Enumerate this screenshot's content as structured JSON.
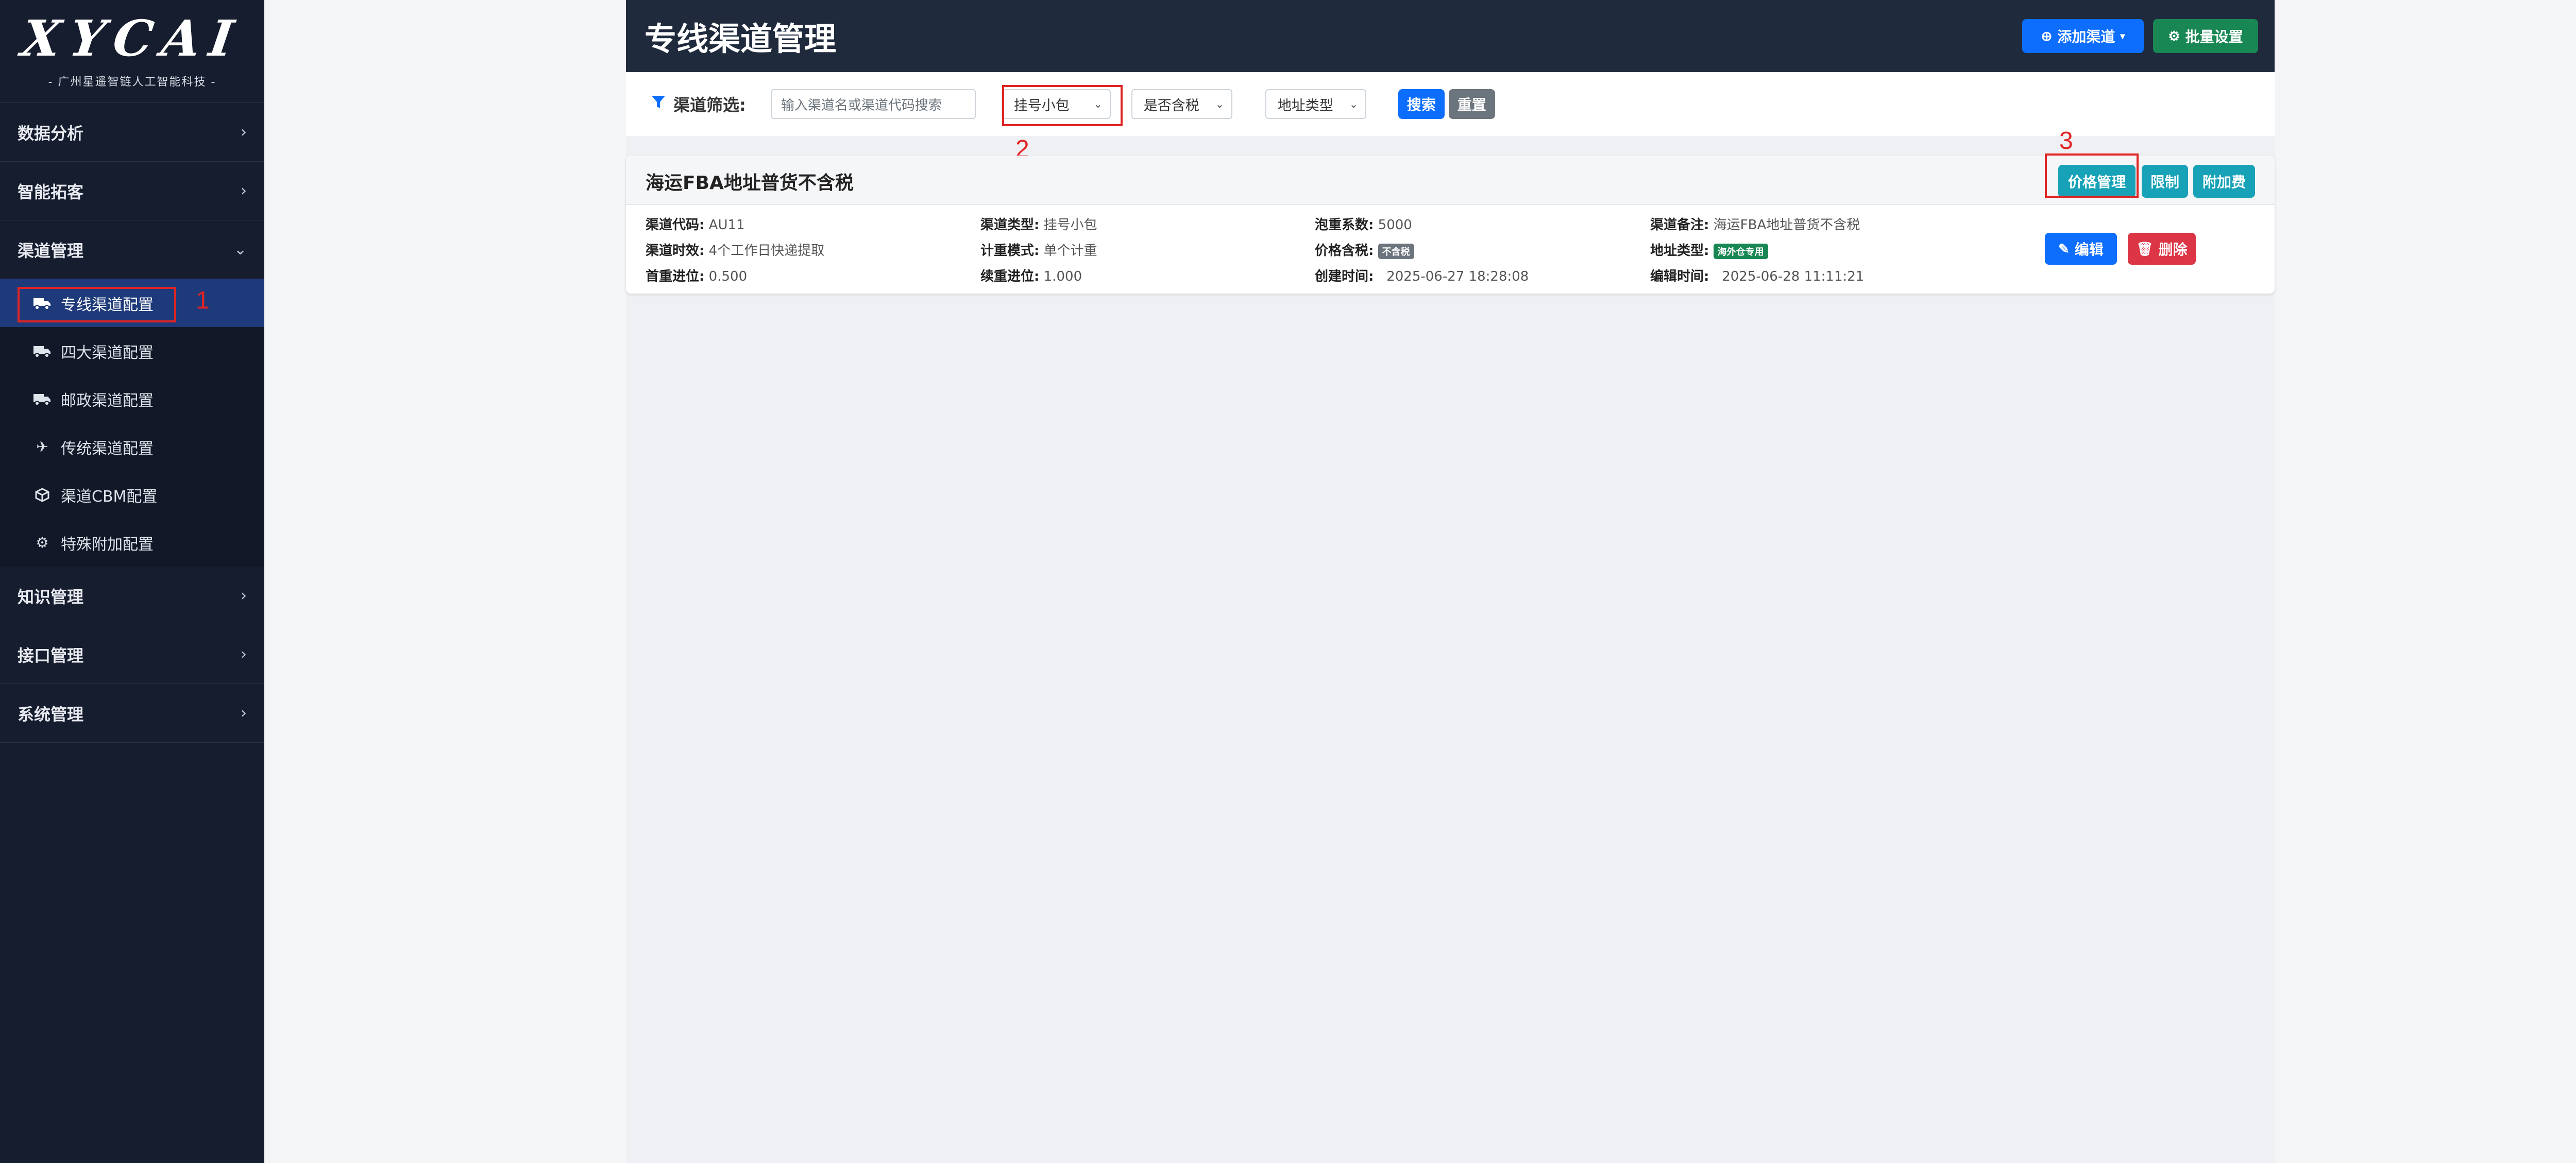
{
  "sidebar": {
    "logo_text": "XYCAI",
    "logo_sub": "- 广州星遥智链人工智能科技 -",
    "groups": [
      {
        "label": "数据分析",
        "chevron": "›"
      },
      {
        "label": "智能拓客",
        "chevron": "›"
      },
      {
        "label": "渠道管理",
        "chevron": "⌄"
      },
      {
        "label": "知识管理",
        "chevron": "›"
      },
      {
        "label": "接口管理",
        "chevron": "›"
      },
      {
        "label": "系统管理",
        "chevron": "›"
      }
    ],
    "subitems": [
      {
        "label": "专线渠道配置",
        "icon": "truck-icon",
        "active": true
      },
      {
        "label": "四大渠道配置",
        "icon": "truck-icon"
      },
      {
        "label": "邮政渠道配置",
        "icon": "truck-icon"
      },
      {
        "label": "传统渠道配置",
        "icon": "plane-icon"
      },
      {
        "label": "渠道CBM配置",
        "icon": "box-icon"
      },
      {
        "label": "特殊附加配置",
        "icon": "gear-icon"
      }
    ]
  },
  "header": {
    "title": "专线渠道管理",
    "add_channel_label": "添加渠道",
    "batch_settings_label": "批量设置"
  },
  "filter": {
    "label": "渠道筛选:",
    "search_placeholder": "输入渠道名或渠道代码搜索",
    "channel_type_value": "挂号小包",
    "tax_value": "是否含税",
    "address_type_value": "地址类型",
    "search_label": "搜索",
    "reset_label": "重置"
  },
  "channel_card": {
    "title": "海运FBA地址普货不含税",
    "price_mgmt_label": "价格管理",
    "limit_label": "限制",
    "surcharge_label": "附加费",
    "edit_label": "编辑",
    "delete_label": "删除",
    "fields": {
      "code_label": "渠道代码:",
      "code": "AU11",
      "type_label": "渠道类型:",
      "type": "挂号小包",
      "volume_label": "泡重系数:",
      "volume": "5000",
      "note_label": "渠道备注:",
      "note": "海运FBA地址普货不含税",
      "timeliness_label": "渠道时效:",
      "timeliness": "4个工作日快递提取",
      "billing_label": "计重模式:",
      "billing": "单个计重",
      "tax_label": "价格含税:",
      "tax_badge": "不含税",
      "addr_label": "地址类型:",
      "addr_badge": "海外仓专用",
      "first_label": "首重进位:",
      "first": "0.500",
      "cont_label": "续重进位:",
      "cont": "1.000",
      "created_label": "创建时间:",
      "created": "2025-06-27 18:28:08",
      "edited_label": "编辑时间:",
      "edited": "2025-06-28 11:11:21"
    }
  },
  "annotations": {
    "n1": "1",
    "n2": "2",
    "n3": "3"
  },
  "colors": {
    "sidebar_bg": "#161d2f",
    "header_bg": "#1f2a3d",
    "primary": "#0d6efd",
    "success": "#198754",
    "info": "#17a2b8",
    "danger": "#dc3545",
    "annotation_red": "#e02424"
  }
}
